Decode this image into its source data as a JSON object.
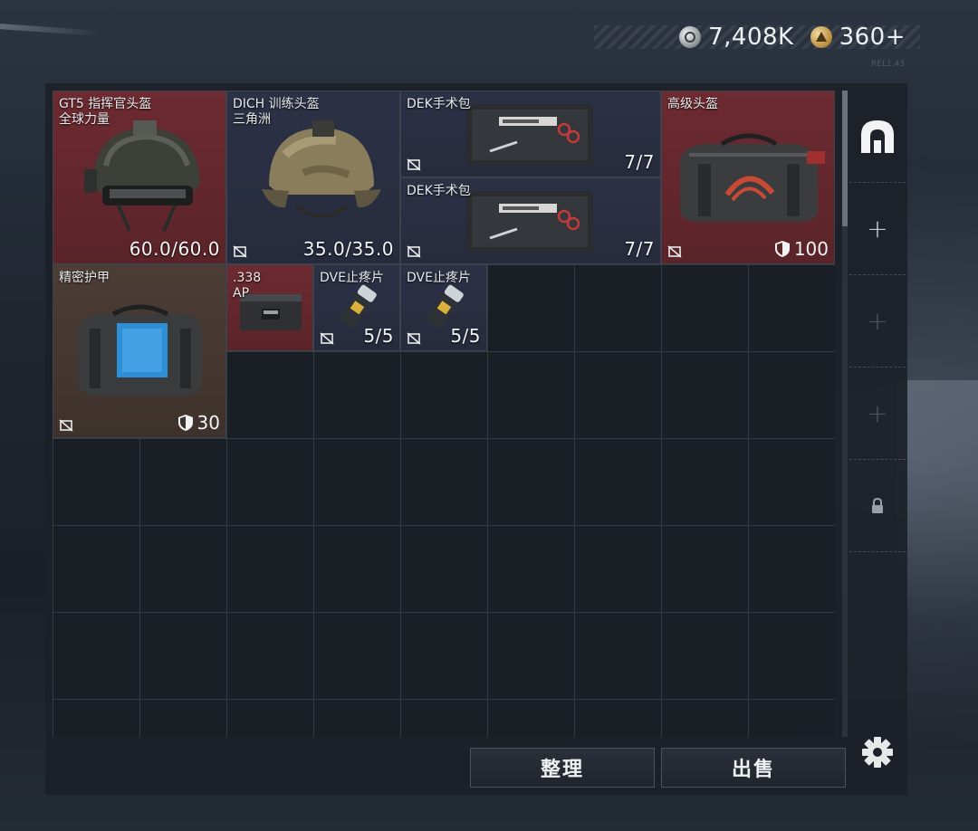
{
  "currency": [
    {
      "icon": "silver-coin-icon",
      "value": "7,408K"
    },
    {
      "icon": "gold-coin-icon",
      "value": "360+"
    }
  ],
  "version_text": "REL1.43",
  "inventory_items": [
    {
      "name": "GT5 指挥官头盔\n全球力量",
      "value": "60.0/60.0",
      "rarity_color": "#6d2a31",
      "icon": "helmet-icon"
    },
    {
      "name": "DICH 训练头盔\n三角洲",
      "value": "35.0/35.0",
      "rarity_color": "#2c3146",
      "icon": "helmet-icon"
    },
    {
      "name": "DEK手术包",
      "value": "7/7",
      "rarity_color": "#2c3146",
      "icon": "surgical-kit-icon"
    },
    {
      "name": "DEK手术包",
      "value": "7/7",
      "rarity_color": "#2c3146",
      "icon": "surgical-kit-icon"
    },
    {
      "name": "高级头盔",
      "value": "100",
      "rarity_color": "#6d2a31",
      "icon": "duffel-bag-icon"
    },
    {
      "name": "精密护甲",
      "value": "30",
      "rarity_color": "#4c3d35",
      "icon": "armor-bag-icon"
    },
    {
      "name": ".338\nAP",
      "value": "",
      "rarity_color": "#6d2a31",
      "icon": "ammo-box-icon"
    },
    {
      "name": "DVE止疼片",
      "value": "5/5",
      "rarity_color": "#2c3146",
      "icon": "painkiller-icon"
    },
    {
      "name": "DVE止疼片",
      "value": "5/5",
      "rarity_color": "#2c3146",
      "icon": "painkiller-icon"
    }
  ],
  "side_toolbar": [
    {
      "icon": "backpack-slot-icon",
      "label": ""
    },
    {
      "icon": "plus-icon",
      "label": "+"
    },
    {
      "icon": "plus-icon",
      "label": "+"
    },
    {
      "icon": "plus-icon",
      "label": "+"
    },
    {
      "icon": "lock-icon",
      "label": ""
    }
  ],
  "buttons": {
    "sort_label": "整理",
    "sell_label": "出售"
  }
}
